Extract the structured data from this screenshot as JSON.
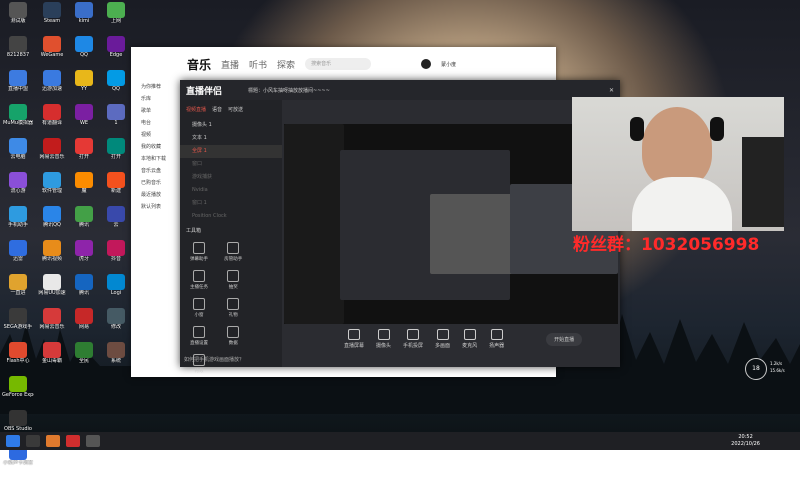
{
  "desktop_left_icons": [
    {
      "label": "测试版",
      "color": "#555"
    },
    {
      "label": "8212837",
      "color": "#444"
    },
    {
      "label": "直播中盟",
      "color": "#3d7be0"
    },
    {
      "label": "MuMu模拟器",
      "color": "#16a36a"
    },
    {
      "label": "云电脑",
      "color": "#3e8ae6"
    },
    {
      "label": "流心游",
      "color": "#8a4fd8"
    },
    {
      "label": "手机助手",
      "color": "#2e9be0"
    },
    {
      "label": "迅雷",
      "color": "#2f6de0"
    },
    {
      "label": "一直进",
      "color": "#e0a32e"
    },
    {
      "label": "SEGA游戏手",
      "color": "#3a3a3a"
    },
    {
      "label": "Flash中心",
      "color": "#e04a2e"
    },
    {
      "label": "GeForce Experience",
      "color": "#76b900"
    },
    {
      "label": "OBS Studio",
      "color": "#333"
    },
    {
      "label": "小新声卡调音",
      "color": "#2d6ae0"
    }
  ],
  "desktop_col2_icons": [
    {
      "label": "Steam",
      "color": "#2a3f5a"
    },
    {
      "label": "WeGame",
      "color": "#e0502e"
    },
    {
      "label": "迅游加速",
      "color": "#3a7ae0"
    },
    {
      "label": "有道翻译",
      "color": "#d62e2e"
    },
    {
      "label": "网易云音乐",
      "color": "#c21c1c"
    },
    {
      "label": "软件管理",
      "color": "#2e9be0"
    },
    {
      "label": "腾讯QQ",
      "color": "#2a85e8"
    },
    {
      "label": "腾讯视频",
      "color": "#e88c1a"
    },
    {
      "label": "网易UU加速",
      "color": "#e8e8e8"
    },
    {
      "label": "网易云音乐",
      "color": "#d63a3a"
    },
    {
      "label": "金山毒霸",
      "color": "#d63a3a"
    }
  ],
  "music": {
    "tabs": [
      "音乐",
      "直播",
      "听书",
      "探索"
    ],
    "search": "搜索音乐",
    "side": [
      "为你推荐",
      "乐库",
      "歌单",
      "电台",
      "视频",
      "我的收藏",
      "本地和下载",
      "音乐云盘",
      "已购音乐",
      "最近播放",
      "默认列表"
    ],
    "user": "蒙小度"
  },
  "obs": {
    "title": "直播伴侣",
    "room_label": "標題：小风车抽呀抽放放播间~~~~",
    "left_tabs": [
      "视频直播",
      "语音",
      "可放送"
    ],
    "scenes": [
      "摄像头 1",
      "文本 1",
      "全屏 1",
      "窗口",
      "游戏捕获",
      "Nvidia",
      "窗口 1",
      "Position Clock"
    ],
    "tools_title": "工具箱",
    "tools": [
      "弹幕助手",
      "房管助手",
      "主播任务",
      "抽奖",
      "小窗",
      "礼物",
      "直播设置",
      "数据",
      "特效",
      "营收",
      "更多"
    ],
    "bottom": [
      "直播屏幕",
      "摄像头",
      "手机投屏",
      "多画面",
      "麦克风",
      "扬声器"
    ],
    "start": "开始直播",
    "notice": "如何把手机游戏画面播放？"
  },
  "fans": "粉丝群：1032056998",
  "clock": {
    "time": "20:52",
    "date": "2022/10/26"
  },
  "speed": {
    "up": "1.2k/s",
    "down": "15.6k/s",
    "cpu": "18"
  }
}
